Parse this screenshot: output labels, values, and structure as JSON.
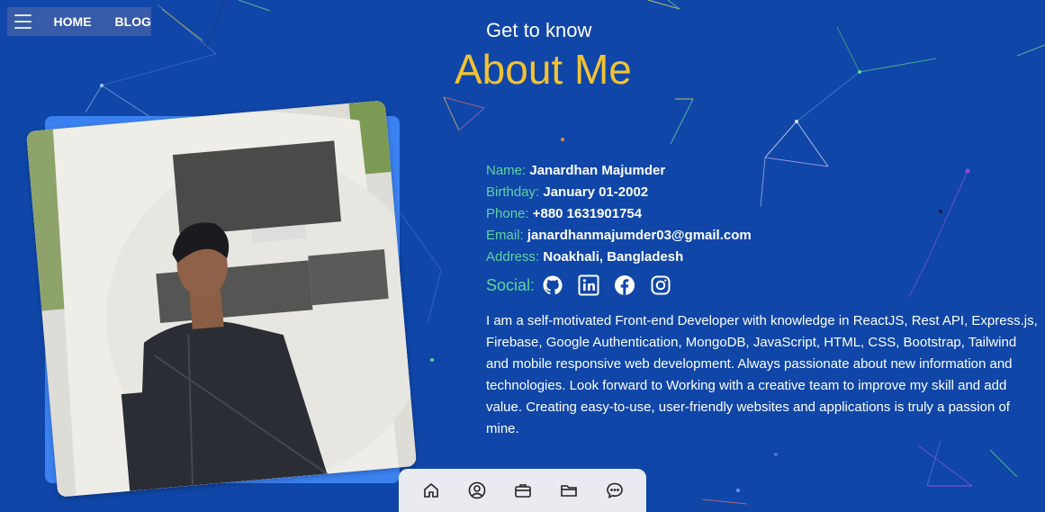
{
  "nav": {
    "home_label": "HOME",
    "blog_label": "BLOG"
  },
  "header": {
    "kicker": "Get to know",
    "title": "About Me"
  },
  "profile": {
    "name_label": "Name:",
    "name_value": "Janardhan Majumder",
    "birthday_label": "Birthday:",
    "birthday_value": "January 01-2002",
    "phone_label": "Phone:",
    "phone_value": "+880 1631901754",
    "email_label": "Email:",
    "email_value": "janardhanmajumder03@gmail.com",
    "address_label": "Address:",
    "address_value": "Noakhali, Bangladesh",
    "social_label": "Social:",
    "social_icons": [
      "github-icon",
      "linkedin-icon",
      "facebook-icon",
      "instagram-icon"
    ]
  },
  "bio": "I am a self-motivated Front-end Developer with knowledge in ReactJS, Rest API, Express.js, Firebase, Google Authentication, MongoDB, JavaScript, HTML, CSS, Bootstrap, Tailwind and mobile responsive web development. Always passionate about new information and technologies. Look forward to Working with a creative team to improve my skill and add value. Creating easy-to-use, user-friendly websites and applications is truly a passion of mine.",
  "dock_icons": [
    "home-icon",
    "user-icon",
    "briefcase-icon",
    "folder-icon",
    "chat-icon"
  ],
  "colors": {
    "background": "#0f46a8",
    "accent_title": "#f1c232",
    "label": "#5fd3a0",
    "photo_frame": "#3b82f0",
    "dock": "#e9ebf0"
  }
}
